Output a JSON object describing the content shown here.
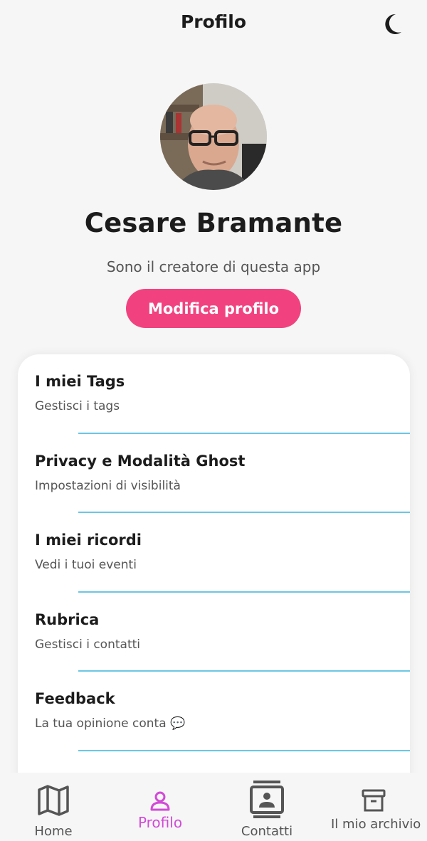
{
  "header": {
    "title": "Profilo",
    "theme_icon": "moon-icon"
  },
  "profile": {
    "name": "Cesare Bramante",
    "bio": "Sono il creatore di questa app",
    "edit_button": "Modifica profilo"
  },
  "menu": [
    {
      "title": "I miei Tags",
      "subtitle": "Gestisci i tags"
    },
    {
      "title": "Privacy e Modalità Ghost",
      "subtitle": "Impostazioni di visibilità"
    },
    {
      "title": "I miei ricordi",
      "subtitle": "Vedi i tuoi eventi"
    },
    {
      "title": "Rubrica",
      "subtitle": "Gestisci i contatti"
    },
    {
      "title": "Feedback",
      "subtitle": "La tua opinione conta 💬"
    }
  ],
  "nav": [
    {
      "label": "Home",
      "icon": "map-icon",
      "active": false
    },
    {
      "label": "Profilo",
      "icon": "person-icon",
      "active": true
    },
    {
      "label": "Contatti",
      "icon": "contacts-icon",
      "active": false
    },
    {
      "label": "Il mio archivio",
      "icon": "archive-icon",
      "active": false
    }
  ],
  "colors": {
    "accent": "#f1427f",
    "active_nav": "#d24ad8",
    "divider": "#6cc6e3",
    "background": "#f6f6f6"
  }
}
